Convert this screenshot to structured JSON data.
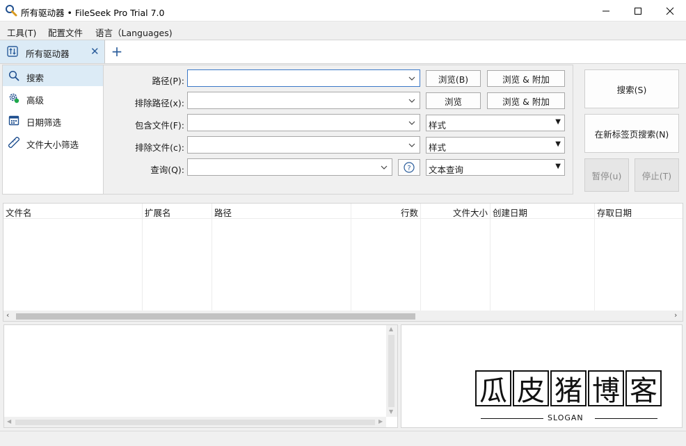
{
  "window": {
    "title": "所有驱动器 • FileSeek Pro Trial 7.0",
    "app_icon": "magnifier-icon",
    "controls": [
      "minimize-icon",
      "maximize-icon",
      "close-icon"
    ]
  },
  "menu": {
    "items": [
      "工具(T)",
      "配置文件",
      "语言（Languages)"
    ]
  },
  "tabs": {
    "active_label": "所有驱动器",
    "close_glyph": "✕",
    "add_glyph": "+"
  },
  "sidebar": {
    "items": [
      {
        "label": "搜索",
        "icon": "search-icon",
        "active": true
      },
      {
        "label": "高级",
        "icon": "settings-gear-icon",
        "active": false
      },
      {
        "label": "日期筛选",
        "icon": "calendar-icon",
        "active": false
      },
      {
        "label": "文件大小筛选",
        "icon": "ruler-icon",
        "active": false
      }
    ]
  },
  "form": {
    "path_label": "路径(P):",
    "exclude_path_label": "排除路径(x):",
    "include_files_label": "包含文件(F):",
    "exclude_files_label": "排除文件(c):",
    "query_label": "查询(Q):",
    "path_value": "",
    "exclude_path_value": "",
    "include_files_value": "",
    "exclude_files_value": "",
    "query_value": "",
    "browse_b_label": "浏览(B)",
    "browse_add_label": "浏览 & 附加",
    "browse_label": "浏览",
    "browse_add_label_2": "浏览 & 附加",
    "include_style_value": "样式",
    "exclude_style_value": "样式",
    "query_type_value": "文本查询",
    "help_glyph": "?"
  },
  "actions": {
    "search_label": "搜索(S)",
    "search_new_tab_label": "在新标签页搜索(N)",
    "pause_label": "暂停(u)",
    "stop_label": "停止(T)"
  },
  "results": {
    "columns": [
      "文件名",
      "扩展名",
      "路径",
      "行数",
      "文件大小",
      "创建日期",
      "存取日期"
    ],
    "rows": []
  },
  "watermark": {
    "chars": [
      "瓜",
      "皮",
      "猪",
      "博",
      "客"
    ],
    "slogan": "SLOGAN"
  },
  "colors": {
    "accent": "#2b5d9b",
    "selected_bg": "#dcebf6",
    "focus_border": "#3b78c7"
  }
}
